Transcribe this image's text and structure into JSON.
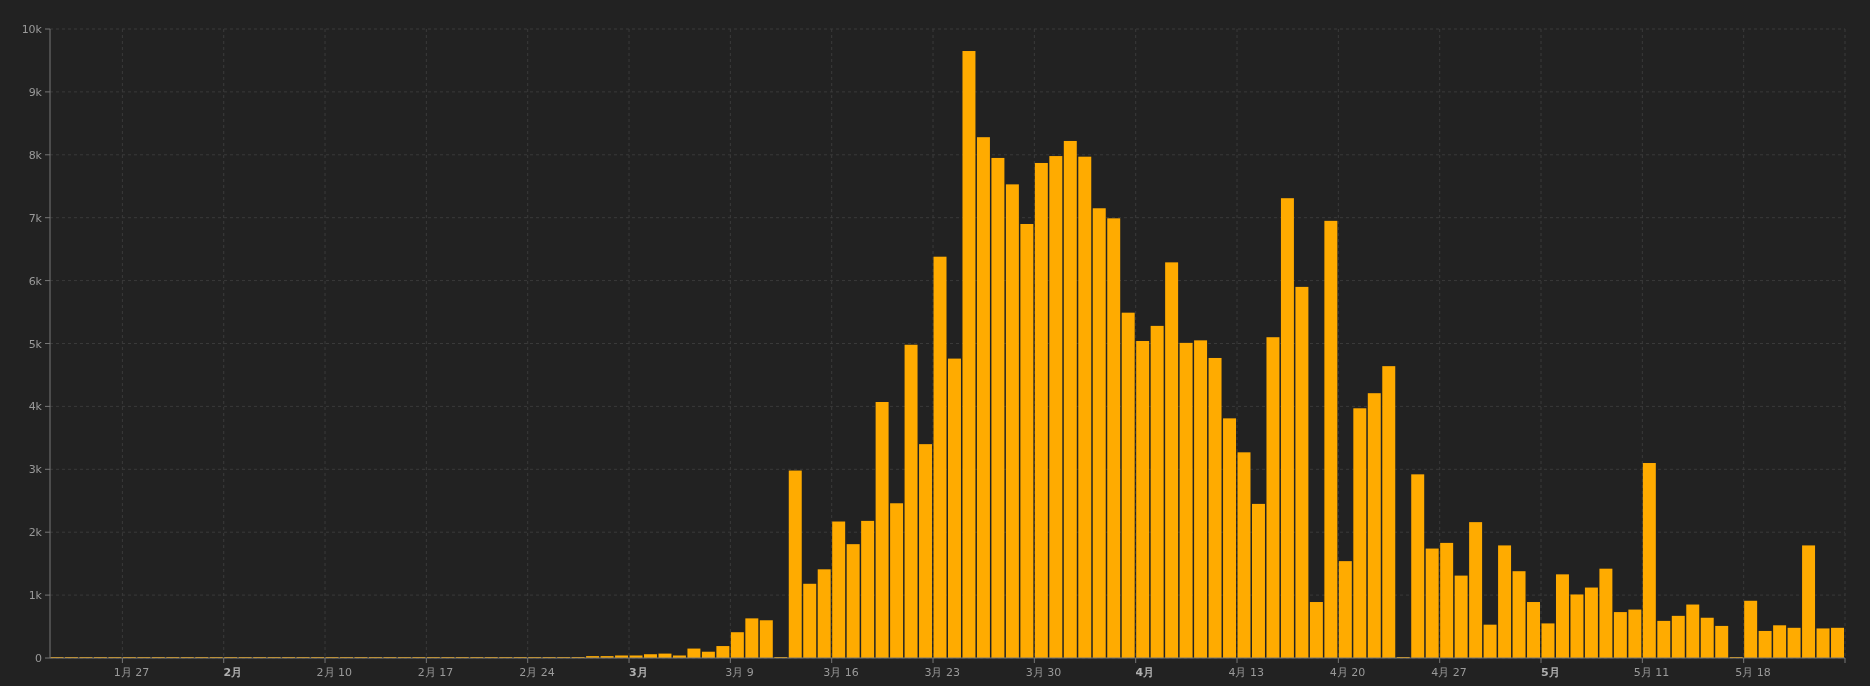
{
  "chart_data": {
    "type": "bar",
    "grid": true,
    "categories": [
      null,
      null,
      null,
      null,
      null,
      "1月 27",
      null,
      null,
      null,
      null,
      null,
      null,
      "2月",
      null,
      null,
      null,
      null,
      null,
      null,
      "2月 10",
      null,
      null,
      null,
      null,
      null,
      null,
      "2月 17",
      null,
      null,
      null,
      null,
      null,
      null,
      "2月 24",
      null,
      null,
      null,
      null,
      null,
      null,
      "3月",
      null,
      null,
      null,
      null,
      null,
      null,
      "3月 9",
      null,
      null,
      null,
      null,
      null,
      null,
      "3月 16",
      null,
      null,
      null,
      null,
      null,
      null,
      "3月 23",
      null,
      null,
      null,
      null,
      null,
      null,
      "3月 30",
      null,
      null,
      null,
      null,
      null,
      null,
      "4月",
      null,
      null,
      null,
      null,
      null,
      null,
      "4月 13",
      null,
      null,
      null,
      null,
      null,
      null,
      "4月 20",
      null,
      null,
      null,
      null,
      null,
      null,
      "4月 27",
      null,
      null,
      null,
      null,
      null,
      null,
      "5月",
      null,
      null,
      null,
      null,
      null,
      null,
      "5月 11",
      null,
      null,
      null,
      null,
      null,
      null,
      "5月 18",
      null,
      null,
      null,
      null,
      null,
      null
    ],
    "series": [
      {
        "color": "#ffab00",
        "values": [
          0,
          0,
          0,
          0,
          0,
          0,
          0,
          0,
          0,
          0,
          0,
          0,
          0,
          0,
          0,
          0,
          0,
          0,
          0,
          0,
          0,
          0,
          0,
          0,
          0,
          0,
          0,
          0,
          0,
          0,
          0,
          0,
          0,
          0,
          0,
          0,
          0,
          30,
          30,
          40,
          40,
          60,
          70,
          40,
          150,
          100,
          190,
          410,
          630,
          600,
          0,
          2980,
          1180,
          1410,
          2170,
          1810,
          2180,
          4070,
          2460,
          4980,
          3400,
          6380,
          4760,
          9650,
          8280,
          7950,
          7530,
          6900,
          7870,
          7980,
          8220,
          7970,
          7150,
          6990,
          5490,
          5040,
          5280,
          6290,
          5010,
          5050,
          4770,
          3810,
          3270,
          2450,
          5100,
          7310,
          5900,
          890,
          6950,
          1540,
          3970,
          4210,
          4640,
          0,
          2920,
          1740,
          1830,
          1310,
          2160,
          530,
          1790,
          1380,
          890,
          550,
          1330,
          1010,
          1120,
          1420,
          730,
          770,
          3100,
          590,
          670,
          850,
          640,
          510,
          0,
          910,
          430,
          520,
          480,
          1790,
          470,
          480
        ]
      }
    ],
    "ylim": [
      0,
      10000
    ],
    "yticks": [
      {
        "value": 0,
        "label": "0"
      },
      {
        "value": 1000,
        "label": "1k"
      },
      {
        "value": 2000,
        "label": "2k"
      },
      {
        "value": 3000,
        "label": "3k"
      },
      {
        "value": 4000,
        "label": "4k"
      },
      {
        "value": 5000,
        "label": "5k"
      },
      {
        "value": 6000,
        "label": "6k"
      },
      {
        "value": 7000,
        "label": "7k"
      },
      {
        "value": 8000,
        "label": "8k"
      },
      {
        "value": 9000,
        "label": "9k"
      },
      {
        "value": 10000,
        "label": "10k"
      }
    ]
  }
}
